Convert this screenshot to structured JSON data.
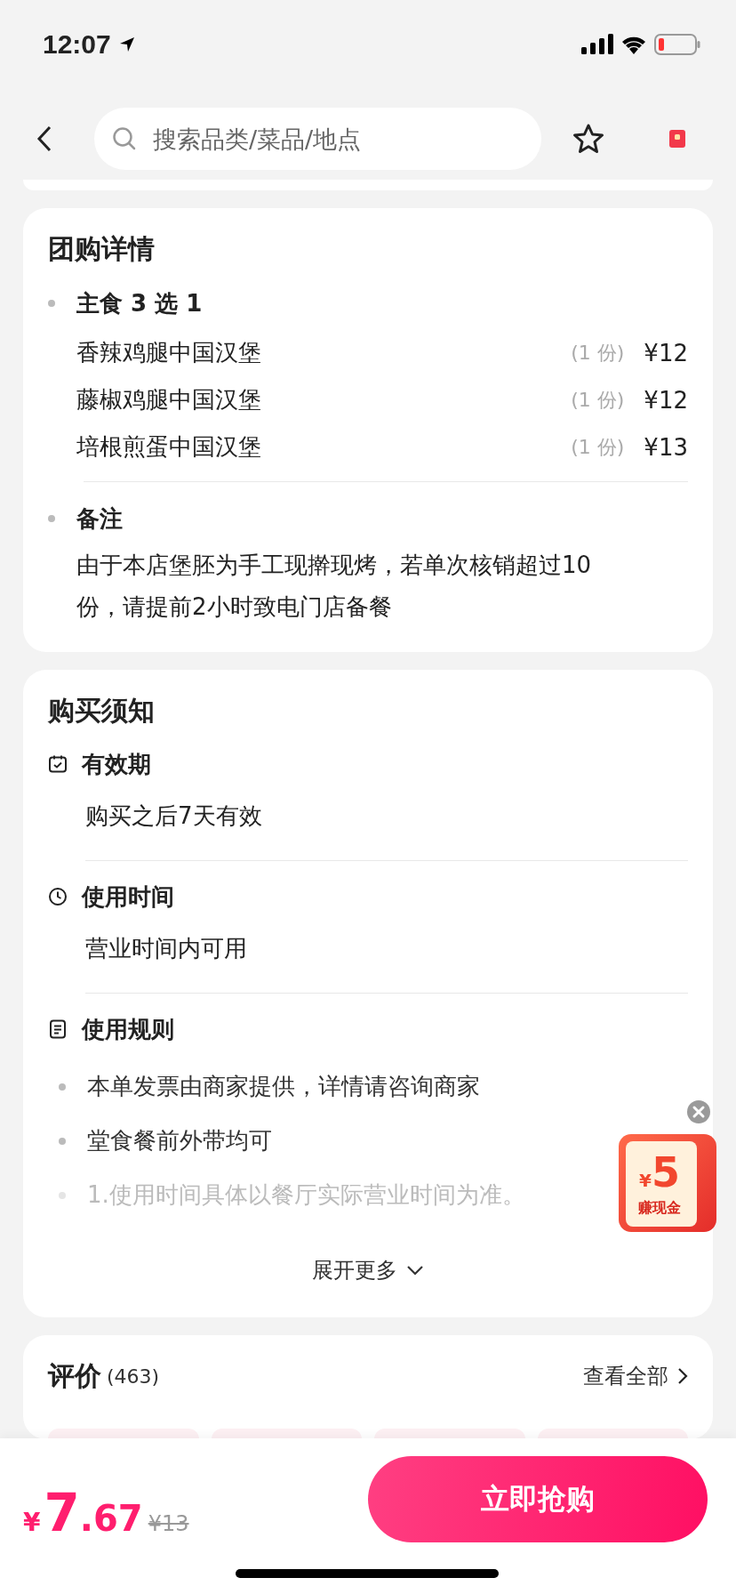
{
  "status_bar": {
    "time": "12:07"
  },
  "header": {
    "search": {
      "placeholder": "搜索品类/菜品/地点"
    }
  },
  "package_details": {
    "title": "团购详情",
    "groups": [
      {
        "kind": "dishes",
        "heading": "主食 3 选 1",
        "items": [
          {
            "name": "香辣鸡腿中国汉堡",
            "quantity": "(1 份)",
            "price": "¥12"
          },
          {
            "name": "藤椒鸡腿中国汉堡",
            "quantity": "(1 份)",
            "price": "¥12"
          },
          {
            "name": "培根煎蛋中国汉堡",
            "quantity": "(1 份)",
            "price": "¥13"
          }
        ]
      },
      {
        "kind": "note",
        "heading": "备注",
        "text": "由于本店堡胚为手工现擀现烤，若单次核销超过10份，请提前2小时致电门店备餐"
      }
    ]
  },
  "purchase_notes": {
    "title": "购买须知",
    "sections": [
      {
        "kind": "calendar",
        "heading": "有效期",
        "text": "购买之后7天有效"
      },
      {
        "kind": "clock",
        "heading": "使用时间",
        "text": "营业时间内可用"
      },
      {
        "kind": "rules",
        "heading": "使用规则",
        "bullets": [
          {
            "text": "本单发票由商家提供，详情请咨询商家",
            "faded": false
          },
          {
            "text": "堂食餐前外带均可",
            "faded": false
          },
          {
            "text": "1.使用时间具体以餐厅实际营业时间为准。",
            "faded": true
          }
        ]
      }
    ],
    "expand_link": "展开更多"
  },
  "reviews": {
    "title": "评价",
    "count": "(463)",
    "view_all": "查看全部"
  },
  "coupon_float": {
    "amount": "5",
    "currency": "¥",
    "label": "赚现金"
  },
  "bottom_bar": {
    "currency": "¥",
    "price_int": "7",
    "price_dec": ".67",
    "original_price": "¥13",
    "buy_button": "立即抢购"
  }
}
